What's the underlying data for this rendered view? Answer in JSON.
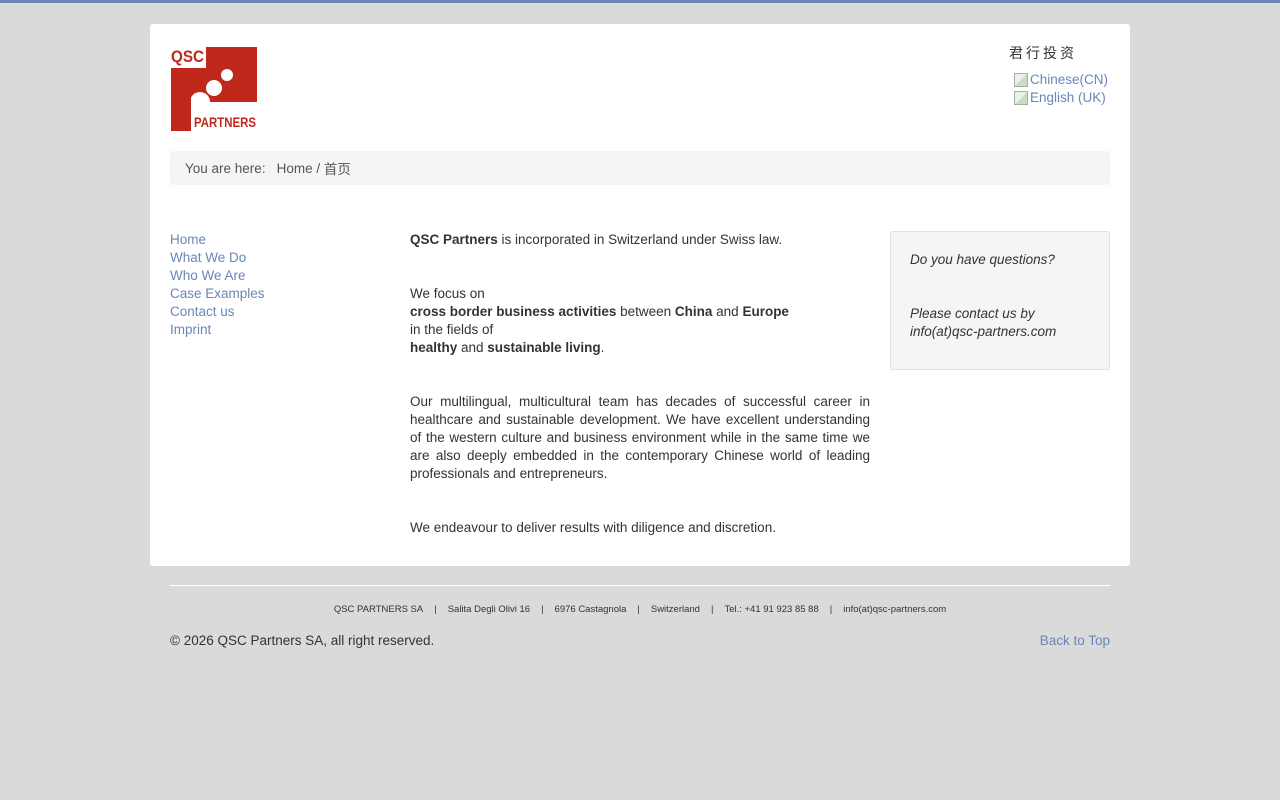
{
  "header": {
    "logo_text": [
      "QSC",
      "PARTNERS"
    ],
    "tagline": "君行投资",
    "languages": [
      {
        "label": "Chinese(CN)"
      },
      {
        "label": "English (UK)"
      }
    ]
  },
  "breadcrumb": {
    "label": "You are here:",
    "home": "Home",
    "separator": " / ",
    "current": "首页"
  },
  "nav": {
    "items": [
      "Home",
      "What We Do",
      "Who We Are",
      "Case Examples",
      "Contact us",
      "Imprint"
    ]
  },
  "content": {
    "p1": {
      "bold": "QSC Partners",
      "rest": " is incorporated in Switzerland under Swiss law."
    },
    "p2": {
      "line1": "We focus on",
      "bold1": "cross border business activities",
      "between": " between ",
      "bold2": "China",
      "and1": " and ",
      "bold3": "Europe",
      "line3": "in the fields of",
      "bold4": "healthy",
      "and2": " and ",
      "bold5": "sustainable living",
      "period": "."
    },
    "p3": "Our multilingual, multicultural team has decades of successful career in healthcare and sustainable development. We have excellent understanding of the western culture and business environment while in the same time we are also deeply embedded in the contemporary Chinese world of leading professionals and entrepreneurs.",
    "p4": "We endeavour to deliver results with diligence and discretion."
  },
  "contact_box": {
    "question": "Do you have questions?",
    "line1": "Please contact us by",
    "email": "info(at)qsc-partners.com"
  },
  "footer": {
    "address": [
      "QSC PARTNERS SA",
      "Salita Degli Olivi 16",
      "6976 Castagnola",
      "Switzerland",
      "Tel.: +41 91 923 85 88",
      "info(at)qsc-partners.com"
    ],
    "separator": "|",
    "copyright": "© 2026 QSC Partners SA, all right reserved.",
    "back_to_top": "Back to Top"
  },
  "colors": {
    "logo_red": "#c0281c",
    "link": "#6a86b8",
    "background": "#dadada"
  }
}
